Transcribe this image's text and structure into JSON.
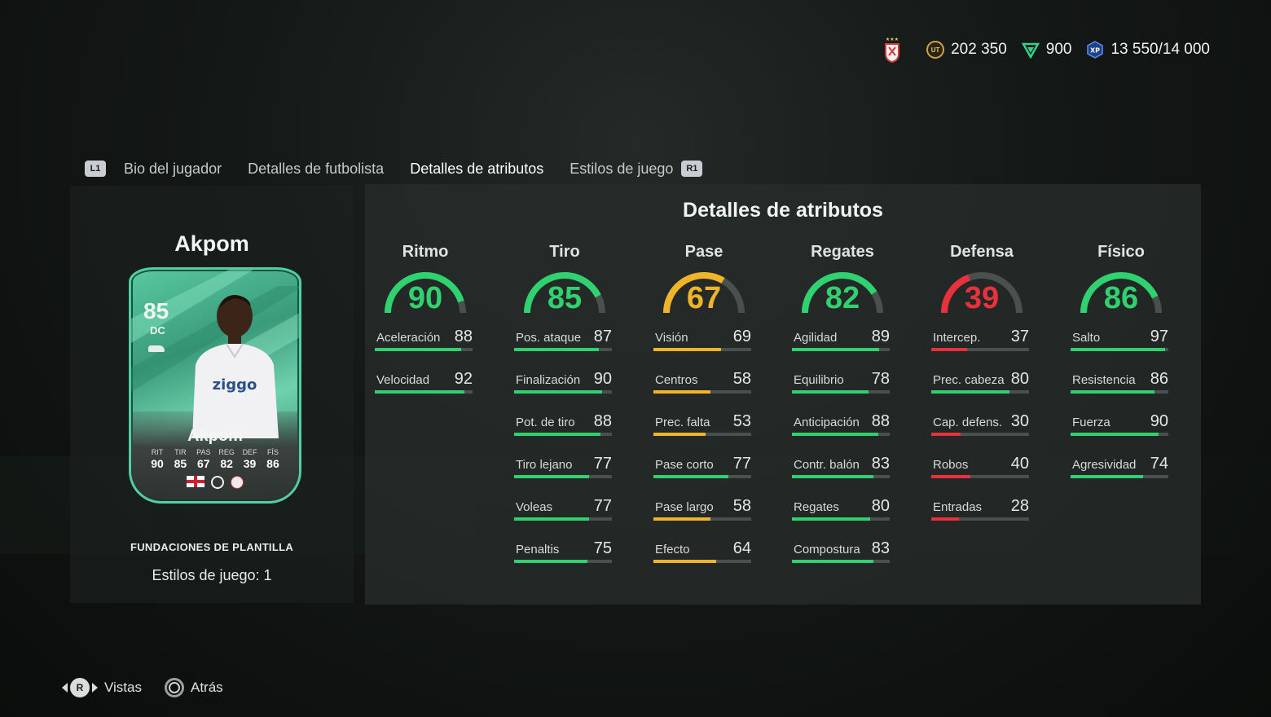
{
  "currency": {
    "coins": "202 350",
    "points": "900",
    "xp": "13 550/14 000"
  },
  "tabs": {
    "left_button": "L1",
    "right_button": "R1",
    "items": [
      {
        "label": "Bio del jugador",
        "active": false
      },
      {
        "label": "Detalles de futbolista",
        "active": false
      },
      {
        "label": "Detalles de atributos",
        "active": true
      },
      {
        "label": "Estilos de juego",
        "active": false
      }
    ]
  },
  "player": {
    "name": "Akpom",
    "rating": "85",
    "position": "DC",
    "card_name": "Akpom",
    "card_stats": [
      {
        "label": "RIT",
        "value": "90"
      },
      {
        "label": "TIR",
        "value": "85"
      },
      {
        "label": "PAS",
        "value": "67"
      },
      {
        "label": "REG",
        "value": "82"
      },
      {
        "label": "DEF",
        "value": "39"
      },
      {
        "label": "FÍS",
        "value": "86"
      }
    ],
    "set_name": "FUNDACIONES DE PLANTILLA",
    "playstyles": "Estilos de juego: 1"
  },
  "attributes": {
    "title": "Detalles de atributos",
    "colors": {
      "green": "#2fd26f",
      "yellow": "#f0b429",
      "red": "#e8313c",
      "track": "#4a504e"
    },
    "categories": [
      {
        "name": "Ritmo",
        "value": "90",
        "color": "green",
        "stats": [
          {
            "name": "Aceleración",
            "value": "88",
            "color": "green"
          },
          {
            "name": "Velocidad",
            "value": "92",
            "color": "green"
          }
        ]
      },
      {
        "name": "Tiro",
        "value": "85",
        "color": "green",
        "stats": [
          {
            "name": "Pos. ataque",
            "value": "87",
            "color": "green"
          },
          {
            "name": "Finalización",
            "value": "90",
            "color": "green"
          },
          {
            "name": "Pot. de tiro",
            "value": "88",
            "color": "green"
          },
          {
            "name": "Tiro lejano",
            "value": "77",
            "color": "green"
          },
          {
            "name": "Voleas",
            "value": "77",
            "color": "green"
          },
          {
            "name": "Penaltis",
            "value": "75",
            "color": "green"
          }
        ]
      },
      {
        "name": "Pase",
        "value": "67",
        "color": "yellow",
        "stats": [
          {
            "name": "Visión",
            "value": "69",
            "color": "yellow"
          },
          {
            "name": "Centros",
            "value": "58",
            "color": "yellow"
          },
          {
            "name": "Prec. falta",
            "value": "53",
            "color": "yellow"
          },
          {
            "name": "Pase corto",
            "value": "77",
            "color": "green"
          },
          {
            "name": "Pase largo",
            "value": "58",
            "color": "yellow"
          },
          {
            "name": "Efecto",
            "value": "64",
            "color": "yellow"
          }
        ]
      },
      {
        "name": "Regates",
        "value": "82",
        "color": "green",
        "stats": [
          {
            "name": "Agilidad",
            "value": "89",
            "color": "green"
          },
          {
            "name": "Equilibrio",
            "value": "78",
            "color": "green"
          },
          {
            "name": "Anticipación",
            "value": "88",
            "color": "green"
          },
          {
            "name": "Contr. balón",
            "value": "83",
            "color": "green"
          },
          {
            "name": "Regates",
            "value": "80",
            "color": "green"
          },
          {
            "name": "Compostura",
            "value": "83",
            "color": "green"
          }
        ]
      },
      {
        "name": "Defensa",
        "value": "39",
        "color": "red",
        "stats": [
          {
            "name": "Intercep.",
            "value": "37",
            "color": "red"
          },
          {
            "name": "Prec. cabeza",
            "value": "80",
            "color": "green"
          },
          {
            "name": "Cap. defens.",
            "value": "30",
            "color": "red"
          },
          {
            "name": "Robos",
            "value": "40",
            "color": "red"
          },
          {
            "name": "Entradas",
            "value": "28",
            "color": "red"
          }
        ]
      },
      {
        "name": "Físico",
        "value": "86",
        "color": "green",
        "stats": [
          {
            "name": "Salto",
            "value": "97",
            "color": "green"
          },
          {
            "name": "Resistencia",
            "value": "86",
            "color": "green"
          },
          {
            "name": "Fuerza",
            "value": "90",
            "color": "green"
          },
          {
            "name": "Agresividad",
            "value": "74",
            "color": "green"
          }
        ]
      }
    ]
  },
  "hints": {
    "stick_button": "R",
    "views_label": "Vistas",
    "back_label": "Atrás"
  }
}
